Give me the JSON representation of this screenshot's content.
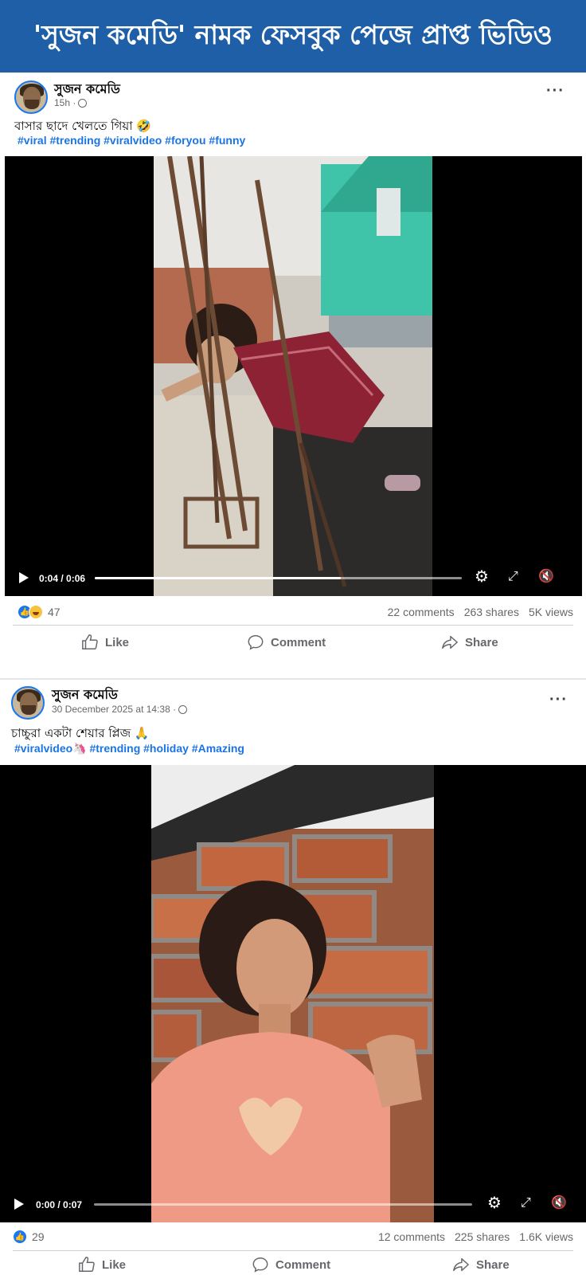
{
  "banner": {
    "title": "'সুজন কমেডি' নামক ফেসবুক পেজে প্রাপ্ত ভিডিও"
  },
  "posts": [
    {
      "page_name": "সুজন কমেডি",
      "time": "15h ·",
      "caption": "বাসার ছাদে খেলতে গিয়া 🤣",
      "hashtags": "#viral #trending #viralvideo #foryou #funny",
      "video": {
        "time_display": "0:04 / 0:06",
        "progress": 0.67
      },
      "reaction_count": "47",
      "comments": "22 comments",
      "shares": "263 shares",
      "views": "5K views",
      "actions": {
        "like": "Like",
        "comment": "Comment",
        "share": "Share"
      }
    },
    {
      "page_name": "সুজন কমেডি",
      "time": "30 December 2025 at 14:38 ·",
      "caption": "চাচ্চুরা একটা শেয়ার প্লিজ 🙏",
      "hashtags": "#viralvideo🦄 #trending #holiday #Amazing",
      "video": {
        "time_display": "0:00 / 0:07",
        "progress": 0.0
      },
      "reaction_count": "29",
      "comments": "12 comments",
      "shares": "225 shares",
      "views": "1.6K views",
      "actions": {
        "like": "Like",
        "comment": "Comment",
        "share": "Share"
      }
    }
  ],
  "icons": [
    "avatar",
    "globe-icon",
    "more-options-icon",
    "play-icon",
    "settings-icon",
    "fullscreen-icon",
    "mute-icon",
    "like-reaction-icon",
    "haha-reaction-icon",
    "like-icon",
    "comment-icon",
    "share-icon"
  ],
  "colors": {
    "banner": "#1f5fa7",
    "hashtag": "#1b74e4",
    "like_blue": "#1877f2"
  }
}
